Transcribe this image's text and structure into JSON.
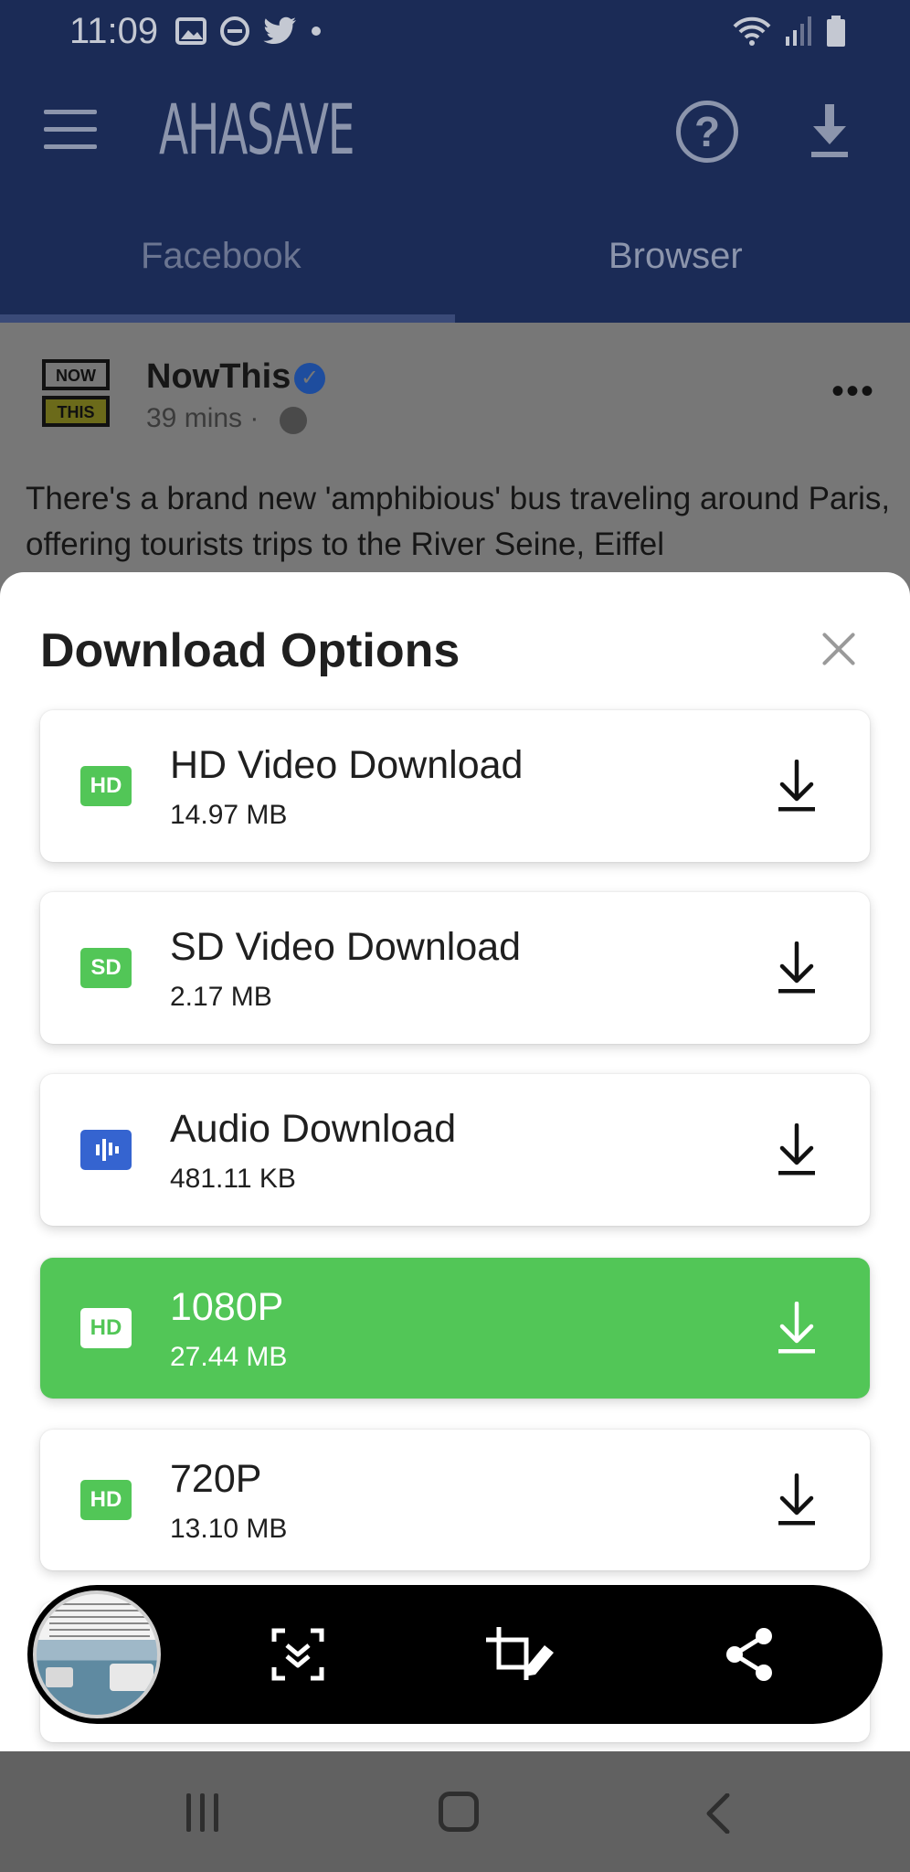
{
  "status_bar": {
    "time": "11:09",
    "left_icons": [
      "image-icon",
      "dnd-icon",
      "twitter-icon",
      "dot-icon"
    ],
    "right_icons": [
      "wifi-icon",
      "signal-icon",
      "battery-icon"
    ]
  },
  "app": {
    "brand": "AHASAVE",
    "header_icons": [
      "menu-icon",
      "help-icon",
      "download-icon"
    ],
    "help_glyph": "?",
    "tabs": [
      {
        "label": "Facebook",
        "active": true
      },
      {
        "label": "Browser",
        "active": false
      }
    ]
  },
  "post": {
    "logo_top": "NOW",
    "logo_bottom": "THIS",
    "author": "NowThis",
    "verified_glyph": "✓",
    "time": "39 mins ·",
    "more_glyph": "•••",
    "text": "There's a brand new 'amphibious' bus traveling around Paris, offering tourists trips to the River Seine, Eiffel"
  },
  "sheet": {
    "title": "Download Options",
    "options": [
      {
        "badge": "HD",
        "title": "HD Video Download",
        "size": "14.97 MB"
      },
      {
        "badge": "SD",
        "title": "SD Video Download",
        "size": "2.17 MB"
      },
      {
        "badge": "audio-wave-icon",
        "title": "Audio Download",
        "size": "481.11 KB"
      },
      {
        "badge": "HD",
        "title": "1080P",
        "size": "27.44 MB",
        "selected": true
      },
      {
        "badge": "HD",
        "title": "720P",
        "size": "13.10 MB"
      }
    ]
  },
  "screenshot_toolbar": {
    "icons": [
      "screenshot-thumbnail",
      "scroll-capture-icon",
      "crop-edit-icon",
      "share-icon"
    ]
  },
  "nav": {
    "icons": [
      "recent-apps-icon",
      "home-icon",
      "back-icon"
    ]
  },
  "colors": {
    "header_bg": "#1b2b56",
    "accent_green": "#52c657",
    "audio_blue": "#3564d0",
    "overlay_gray": "#777777"
  }
}
